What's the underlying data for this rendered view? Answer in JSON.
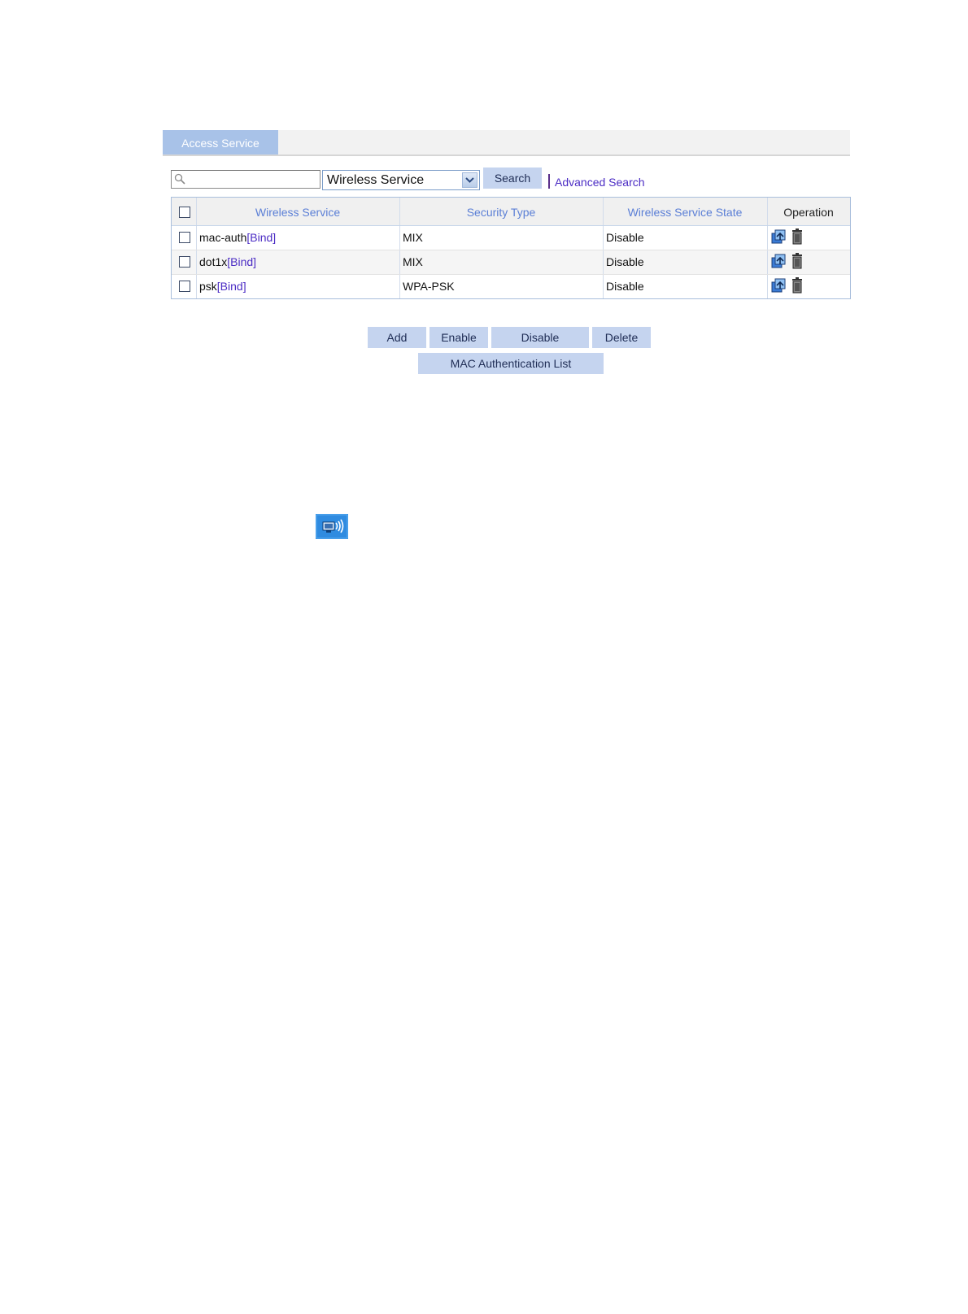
{
  "tabs": [
    {
      "label": "Access Service"
    }
  ],
  "search": {
    "value": "",
    "field_selected": "Wireless Service",
    "search_label": "Search",
    "advanced_label": "Advanced Search"
  },
  "table": {
    "columns": [
      "Wireless Service",
      "Security Type",
      "Wireless Service State",
      "Operation"
    ],
    "rows": [
      {
        "name": "mac-auth",
        "bind": "[Bind]",
        "security": "MIX",
        "state": "Disable"
      },
      {
        "name": "dot1x",
        "bind": "[Bind]",
        "security": "MIX",
        "state": "Disable"
      },
      {
        "name": "psk",
        "bind": "[Bind]",
        "security": "WPA-PSK",
        "state": "Disable"
      }
    ]
  },
  "buttons": {
    "add": "Add",
    "enable": "Enable",
    "disable": "Disable",
    "delete": "Delete",
    "mac_list": "MAC Authentication List"
  },
  "icons": {
    "search": "search-icon",
    "dropdown": "chevron-down-icon",
    "edit": "edit-icon",
    "delete": "trash-icon",
    "wireless": "wireless-service-icon"
  },
  "colors": {
    "tab_active": "#a8c2e8",
    "button_bg": "#c5d4ef",
    "link": "#4b2cc4",
    "header_text": "#5b7fd6"
  }
}
